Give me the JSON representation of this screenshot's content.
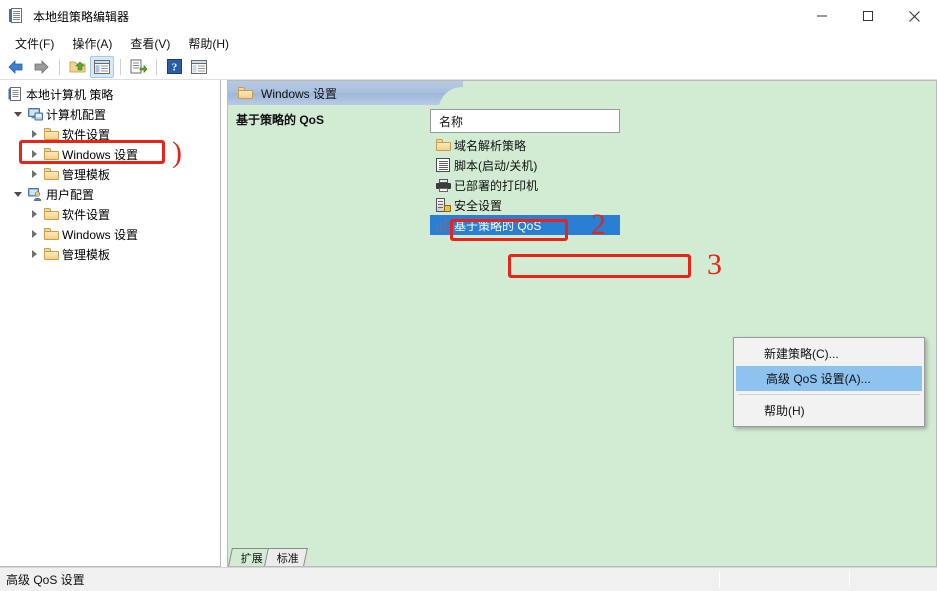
{
  "window": {
    "title": "本地组策略编辑器",
    "icon": "gpedit-icon",
    "controls": {
      "minimize": "minimize-icon",
      "maximize": "maximize-icon",
      "close": "close-icon"
    }
  },
  "menubar": {
    "items": [
      {
        "label": "文件(F)",
        "name": "menu-file"
      },
      {
        "label": "操作(A)",
        "name": "menu-action"
      },
      {
        "label": "查看(V)",
        "name": "menu-view"
      },
      {
        "label": "帮助(H)",
        "name": "menu-help"
      }
    ]
  },
  "toolbar": {
    "buttons": [
      {
        "name": "back-icon",
        "title": "后退"
      },
      {
        "name": "forward-icon",
        "title": "前进"
      },
      {
        "name": "up-folder-icon",
        "title": "上一层"
      },
      {
        "name": "show-hide-tree-icon",
        "title": "显示/隐藏控制台树",
        "active": true
      },
      {
        "name": "export-list-icon",
        "title": "导出列表"
      },
      {
        "name": "help-icon",
        "title": "帮助"
      },
      {
        "name": "properties-icon",
        "title": "属性"
      }
    ]
  },
  "tree": {
    "root": {
      "label": "本地计算机 策略",
      "icon": "console-root-icon"
    },
    "items": [
      {
        "label": "计算机配置",
        "icon": "computer-icon",
        "indent": 1,
        "twisty": "down"
      },
      {
        "label": "软件设置",
        "icon": "folder-icon",
        "indent": 2,
        "twisty": "right"
      },
      {
        "label": "Windows 设置",
        "icon": "folder-icon",
        "indent": 2,
        "twisty": "right",
        "annotated": true
      },
      {
        "label": "管理模板",
        "icon": "folder-icon",
        "indent": 2,
        "twisty": "right"
      },
      {
        "label": "用户配置",
        "icon": "user-icon",
        "indent": 1,
        "twisty": "down"
      },
      {
        "label": "软件设置",
        "icon": "folder-icon",
        "indent": 2,
        "twisty": "right"
      },
      {
        "label": "Windows 设置",
        "icon": "folder-icon",
        "indent": 2,
        "twisty": "right"
      },
      {
        "label": "管理模板",
        "icon": "folder-icon",
        "indent": 2,
        "twisty": "right"
      }
    ]
  },
  "content": {
    "header": {
      "label": "Windows 设置",
      "icon": "folder-icon"
    },
    "selected_title": "基于策略的 QoS",
    "list_header": "名称",
    "list_items": [
      {
        "label": "域名解析策略",
        "icon": "folder-icon",
        "selected": false
      },
      {
        "label": "脚本(启动/关机)",
        "icon": "script-icon",
        "selected": false
      },
      {
        "label": "已部署的打印机",
        "icon": "printer-icon",
        "selected": false
      },
      {
        "label": "安全设置",
        "icon": "security-settings-icon",
        "selected": false
      },
      {
        "label": "基于策略的 QoS",
        "icon": "qos-icon",
        "selected": true
      }
    ]
  },
  "context_menu": {
    "items": [
      {
        "label": "新建策略(C)...",
        "name": "ctx-new-policy",
        "highlighted": false
      },
      {
        "label": "高级 QoS 设置(A)...",
        "name": "ctx-advanced-qos",
        "highlighted": true
      },
      {
        "label": "帮助(H)",
        "name": "ctx-help",
        "highlighted": false
      }
    ]
  },
  "tabs": [
    {
      "label": "扩展",
      "active": true
    },
    {
      "label": "标准",
      "active": false
    }
  ],
  "statusbar": {
    "text": "高级 QoS 设置"
  },
  "annotations": [
    {
      "id": "1",
      "glyph": ")",
      "target": "tree-windows-settings"
    },
    {
      "id": "2",
      "glyph": "2",
      "target": "list-item-qos"
    },
    {
      "id": "3",
      "glyph": "3",
      "target": "ctx-advanced-qos"
    }
  ],
  "colors": {
    "accent_selection": "#2a7fd4",
    "annotation_red": "#e8231a",
    "content_background": "#d2ecd4",
    "menu_highlight": "#8ec3ef",
    "header_gradient_top": "#b7cae4"
  }
}
